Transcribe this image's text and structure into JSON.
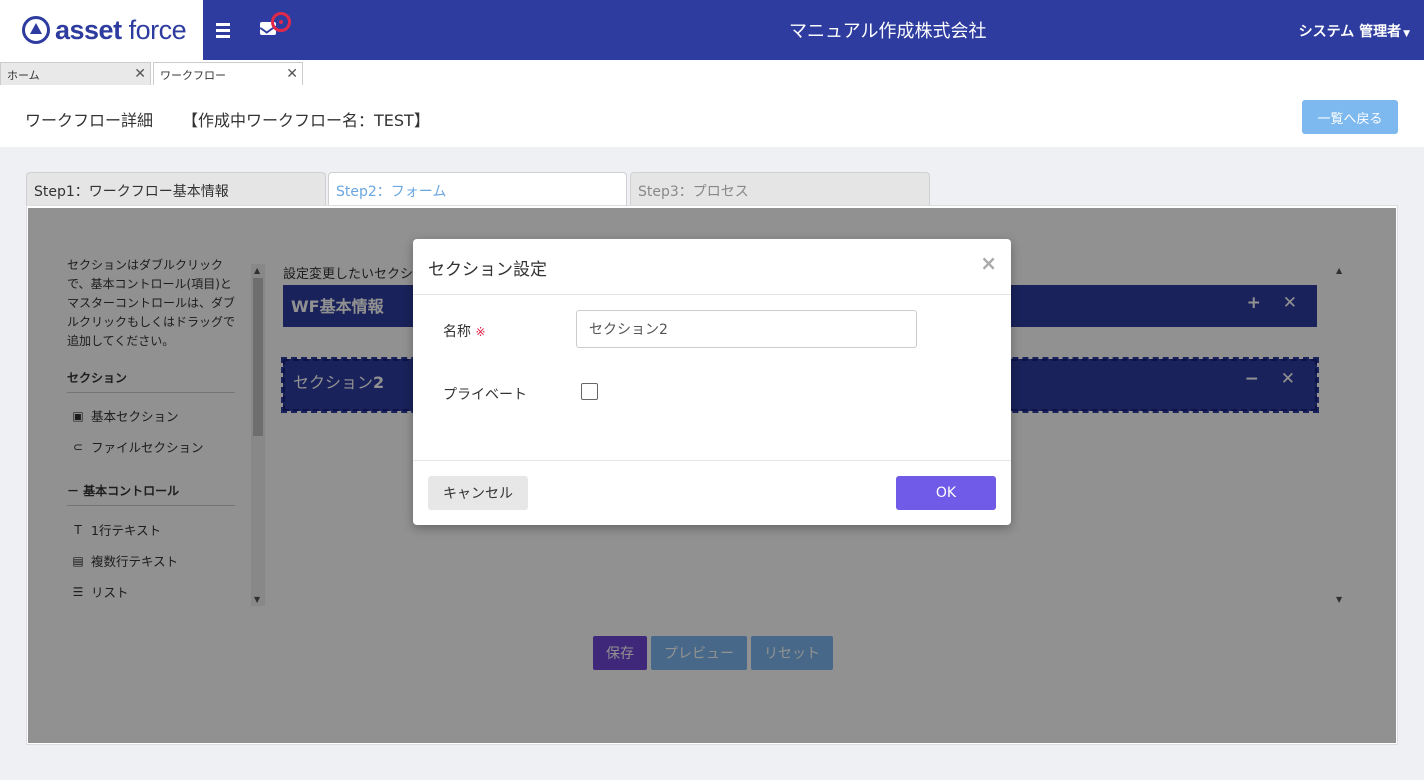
{
  "header": {
    "logo_asset": "asset",
    "logo_force": "force",
    "company": "マニュアル作成株式会社",
    "user": "システム 管理者",
    "brand_color": "#2d3c9e"
  },
  "page_tabs": [
    {
      "label": "ホーム"
    },
    {
      "label": "ワークフロー"
    }
  ],
  "title_bar": {
    "title": "ワークフロー詳細",
    "workflow_name": "【作成中ワークフロー名：TEST】",
    "back_label": "一覧へ戻る"
  },
  "steps": [
    {
      "label": "Step1：ワークフロー基本情報"
    },
    {
      "label": "Step2：フォーム"
    },
    {
      "label": "Step3：プロセス"
    }
  ],
  "sidebar": {
    "help_text": "セクションはダブルクリックで、基本コントロール(項目)とマスターコントロールは、ダブルクリックもしくはドラッグで追加してください。",
    "section_head": "セクション",
    "section_items": [
      {
        "label": "基本セクション",
        "icon": "id-card-icon"
      },
      {
        "label": "ファイルセクション",
        "icon": "paperclip-icon"
      }
    ],
    "control_head": "－ 基本コントロール",
    "control_items": [
      {
        "label": "1行テキスト",
        "icon": "text-icon"
      },
      {
        "label": "複数行テキスト",
        "icon": "document-icon"
      },
      {
        "label": "リスト",
        "icon": "list-icon"
      }
    ]
  },
  "canvas": {
    "hint": "設定変更したいセクション",
    "sections": [
      {
        "label": "WF基本情報",
        "controls": "+ ✕"
      },
      {
        "label_prefix": "セクション",
        "label_num": "2",
        "controls": "− ✕"
      }
    ]
  },
  "actions": {
    "save": "保存",
    "preview": "プレビュー",
    "reset": "リセット"
  },
  "modal": {
    "title": "セクション設定",
    "close": "×",
    "name_label": "名称",
    "required_mark": "※",
    "name_value": "セクション2",
    "private_label": "プライベート",
    "private_checked": false,
    "cancel": "キャンセル",
    "ok": "OK"
  }
}
